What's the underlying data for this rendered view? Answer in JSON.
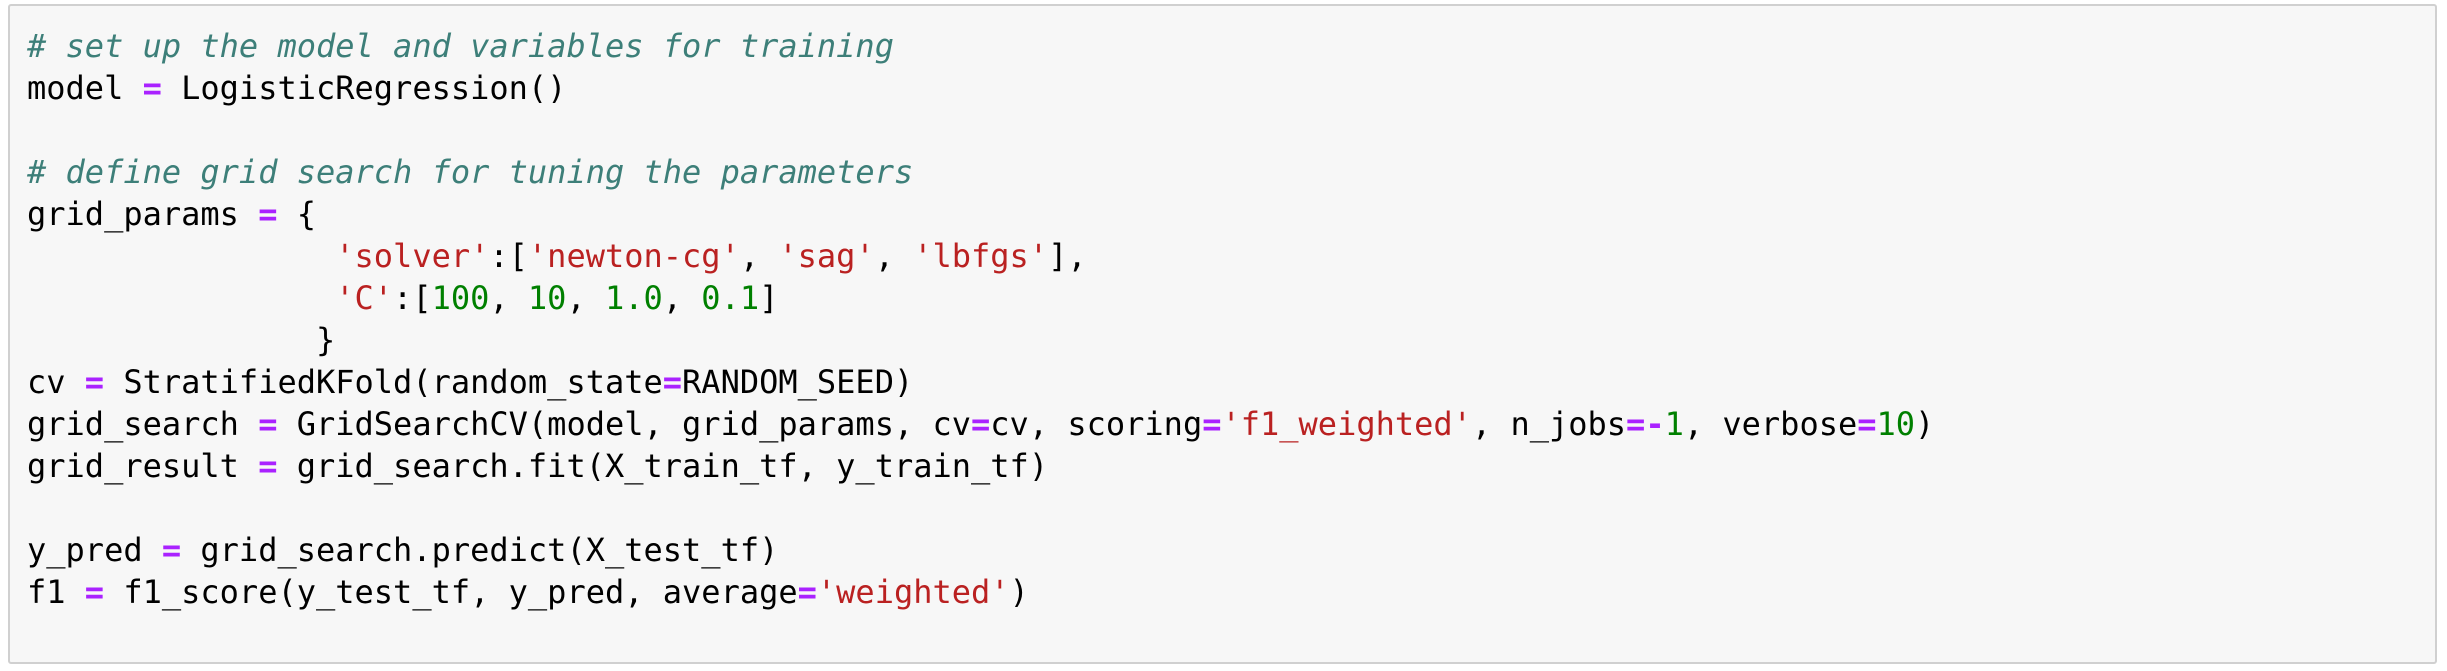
{
  "cell": {
    "lines": [
      [
        {
          "t": "# set up the model and variables for training",
          "k": "c"
        }
      ],
      [
        {
          "t": "model "
        },
        {
          "t": "=",
          "k": "o"
        },
        {
          "t": " LogisticRegression()"
        }
      ],
      [],
      [
        {
          "t": "# define grid search for tuning the parameters",
          "k": "c"
        }
      ],
      [
        {
          "t": "grid_params "
        },
        {
          "t": "=",
          "k": "o"
        },
        {
          "t": " {"
        }
      ],
      [
        {
          "t": "                "
        },
        {
          "t": "'solver'",
          "k": "s"
        },
        {
          "t": ":["
        },
        {
          "t": "'newton-cg'",
          "k": "s"
        },
        {
          "t": ", "
        },
        {
          "t": "'sag'",
          "k": "s"
        },
        {
          "t": ", "
        },
        {
          "t": "'lbfgs'",
          "k": "s"
        },
        {
          "t": "],"
        }
      ],
      [
        {
          "t": "                "
        },
        {
          "t": "'C'",
          "k": "s"
        },
        {
          "t": ":["
        },
        {
          "t": "100",
          "k": "n"
        },
        {
          "t": ", "
        },
        {
          "t": "10",
          "k": "n"
        },
        {
          "t": ", "
        },
        {
          "t": "1.0",
          "k": "n"
        },
        {
          "t": ", "
        },
        {
          "t": "0.1",
          "k": "n"
        },
        {
          "t": "]"
        }
      ],
      [
        {
          "t": "               }"
        }
      ],
      [
        {
          "t": "cv "
        },
        {
          "t": "=",
          "k": "o"
        },
        {
          "t": " StratifiedKFold(random_state"
        },
        {
          "t": "=",
          "k": "o"
        },
        {
          "t": "RANDOM_SEED)"
        }
      ],
      [
        {
          "t": "grid_search "
        },
        {
          "t": "=",
          "k": "o"
        },
        {
          "t": " GridSearchCV(model, grid_params, cv"
        },
        {
          "t": "=",
          "k": "o"
        },
        {
          "t": "cv, scoring"
        },
        {
          "t": "=",
          "k": "o"
        },
        {
          "t": "'f1_weighted'",
          "k": "s"
        },
        {
          "t": ", n_jobs"
        },
        {
          "t": "=-",
          "k": "o"
        },
        {
          "t": "1",
          "k": "n"
        },
        {
          "t": ", verbose"
        },
        {
          "t": "=",
          "k": "o"
        },
        {
          "t": "10",
          "k": "n"
        },
        {
          "t": ")"
        }
      ],
      [
        {
          "t": "grid_result "
        },
        {
          "t": "=",
          "k": "o"
        },
        {
          "t": " grid_search.fit(X_train_tf, y_train_tf)"
        }
      ],
      [],
      [
        {
          "t": "y_pred "
        },
        {
          "t": "=",
          "k": "o"
        },
        {
          "t": " grid_search.predict(X_test_tf)"
        }
      ],
      [
        {
          "t": "f1 "
        },
        {
          "t": "=",
          "k": "o"
        },
        {
          "t": " f1_score(y_test_tf, y_pred, average"
        },
        {
          "t": "=",
          "k": "o"
        },
        {
          "t": "'weighted'",
          "k": "s"
        },
        {
          "t": ")"
        }
      ]
    ]
  },
  "colors": {
    "background": "#f7f7f7",
    "border": "#d0d0d0",
    "comment": "#3d7f79",
    "operator": "#aa22ff",
    "string": "#ba2121",
    "number": "#008000",
    "text": "#000000"
  }
}
